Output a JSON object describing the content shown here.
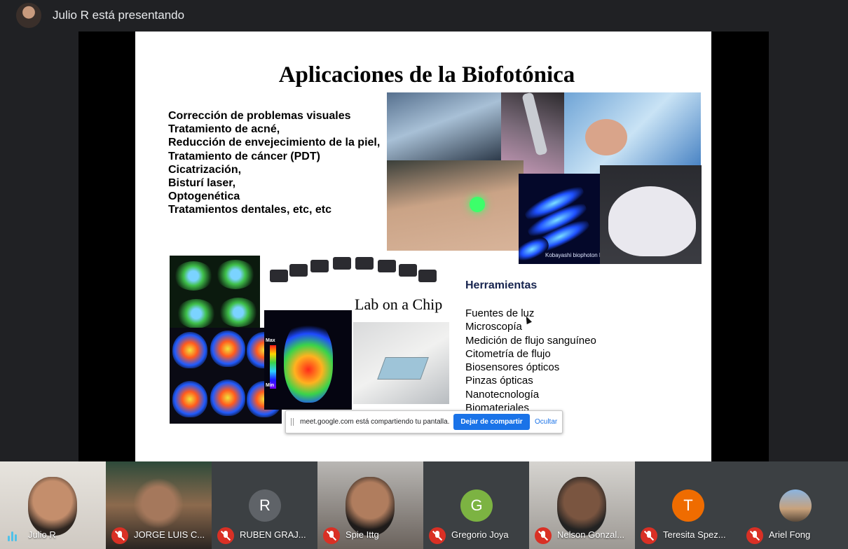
{
  "header": {
    "presenter_text": "Julio R está presentando"
  },
  "slide": {
    "title": "Aplicaciones de la Biofotónica",
    "applications": [
      "Corrección de problemas visuales",
      "Tratamiento de acné,",
      "Reducción de envejecimiento de la piel,",
      "Tratamiento de cáncer (PDT)",
      "Cicatrización,",
      "Bisturí laser,",
      "Optogenética",
      "Tratamientos dentales, etc, etc"
    ],
    "lab_on_chip_label": "Lab on a Chip",
    "biophoton_caption": "Kobayashi biophoton lab",
    "scale_max": "Max",
    "scale_min": "Min",
    "tools_title": "Herramientas",
    "tools": [
      "Fuentes de luz",
      "Microscopía",
      "Medición de flujo sanguíneo",
      "Citometría de flujo",
      "Biosensores ópticos",
      "Pinzas ópticas",
      "Nanotecnología",
      "Biomateriales"
    ]
  },
  "share_bar": {
    "message": "meet.google.com está compartiendo tu pantalla.",
    "stop_label": "Dejar de compartir",
    "hide_label": "Ocultar"
  },
  "participants": [
    {
      "name": "Julio R",
      "status": "speaking"
    },
    {
      "name": "JORGE LUIS C...",
      "status": "muted"
    },
    {
      "name": "RUBEN GRAJ...",
      "status": "muted",
      "initial": "R",
      "avatar_color": "#5f6368"
    },
    {
      "name": "Spie Ittg",
      "status": "muted"
    },
    {
      "name": "Gregorio Joya",
      "status": "muted",
      "initial": "G",
      "avatar_color": "#7cb342"
    },
    {
      "name": "Nelson Gonzal...",
      "status": "muted"
    },
    {
      "name": "Teresita Spez...",
      "status": "muted",
      "initial": "T",
      "avatar_color": "#ef6c00"
    },
    {
      "name": "Ariel Fong",
      "status": "muted"
    }
  ]
}
